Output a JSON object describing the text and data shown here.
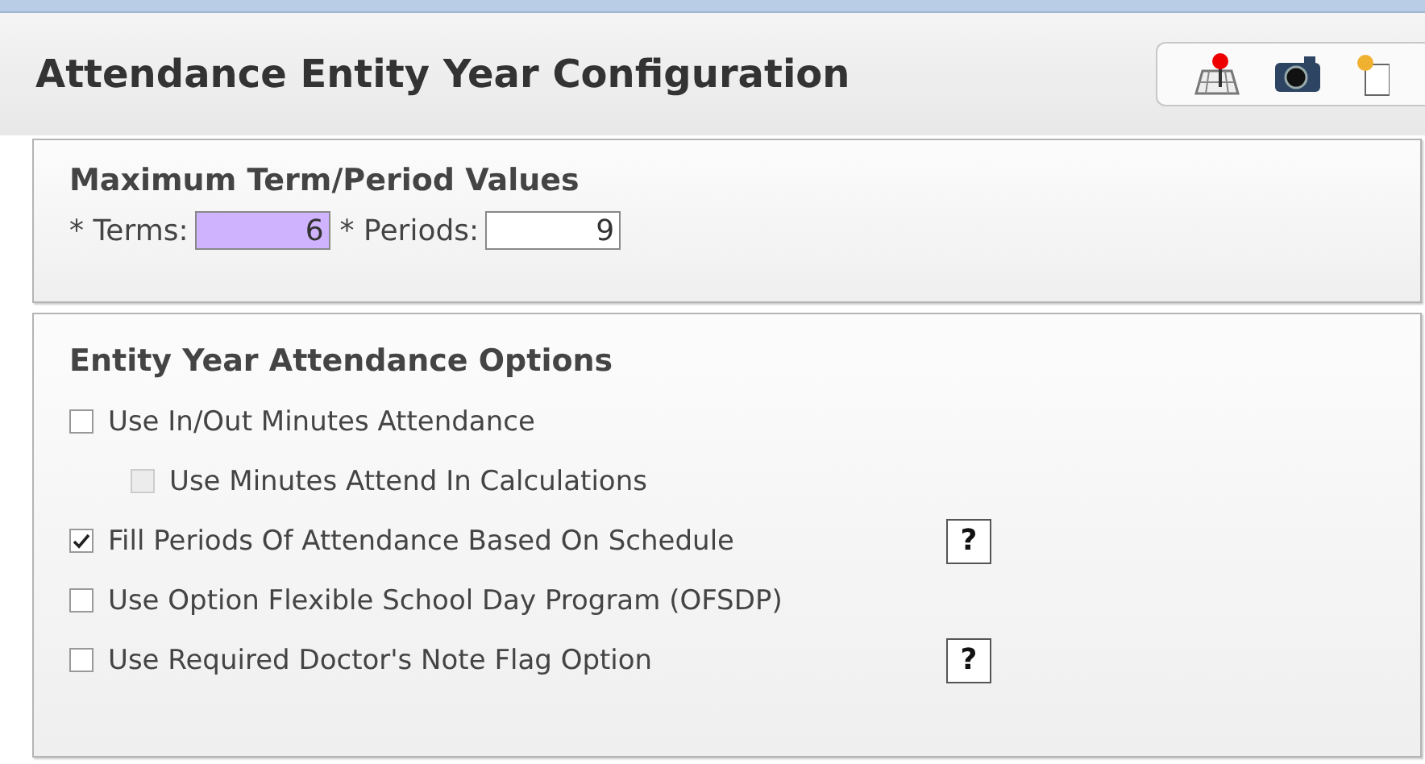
{
  "header": {
    "title": "Attendance Entity Year Configuration"
  },
  "maximum_values": {
    "title": "Maximum Term/Period Values",
    "fields": [
      {
        "label": "* Terms:",
        "value": "6",
        "highlighted": true
      },
      {
        "label": "* Periods:",
        "value": "9",
        "highlighted": false
      }
    ]
  },
  "options": {
    "title": "Entity Year Attendance Options",
    "items": [
      {
        "label": "Use In/Out Minutes Attendance",
        "checked": false,
        "disabled": false,
        "help": false,
        "children": [
          {
            "label": "Use Minutes Attend In Calculations",
            "checked": false,
            "disabled": true,
            "help": false
          }
        ]
      },
      {
        "label": "Fill Periods Of Attendance Based On Schedule",
        "checked": true,
        "disabled": false,
        "help": true,
        "help_label": "?"
      },
      {
        "label": "Use Option Flexible School Day Program (OFSDP)",
        "checked": false,
        "disabled": false,
        "help": false
      },
      {
        "label": "Use Required Doctor's Note Flag Option",
        "checked": false,
        "disabled": false,
        "help": true,
        "help_label": "?"
      }
    ]
  }
}
